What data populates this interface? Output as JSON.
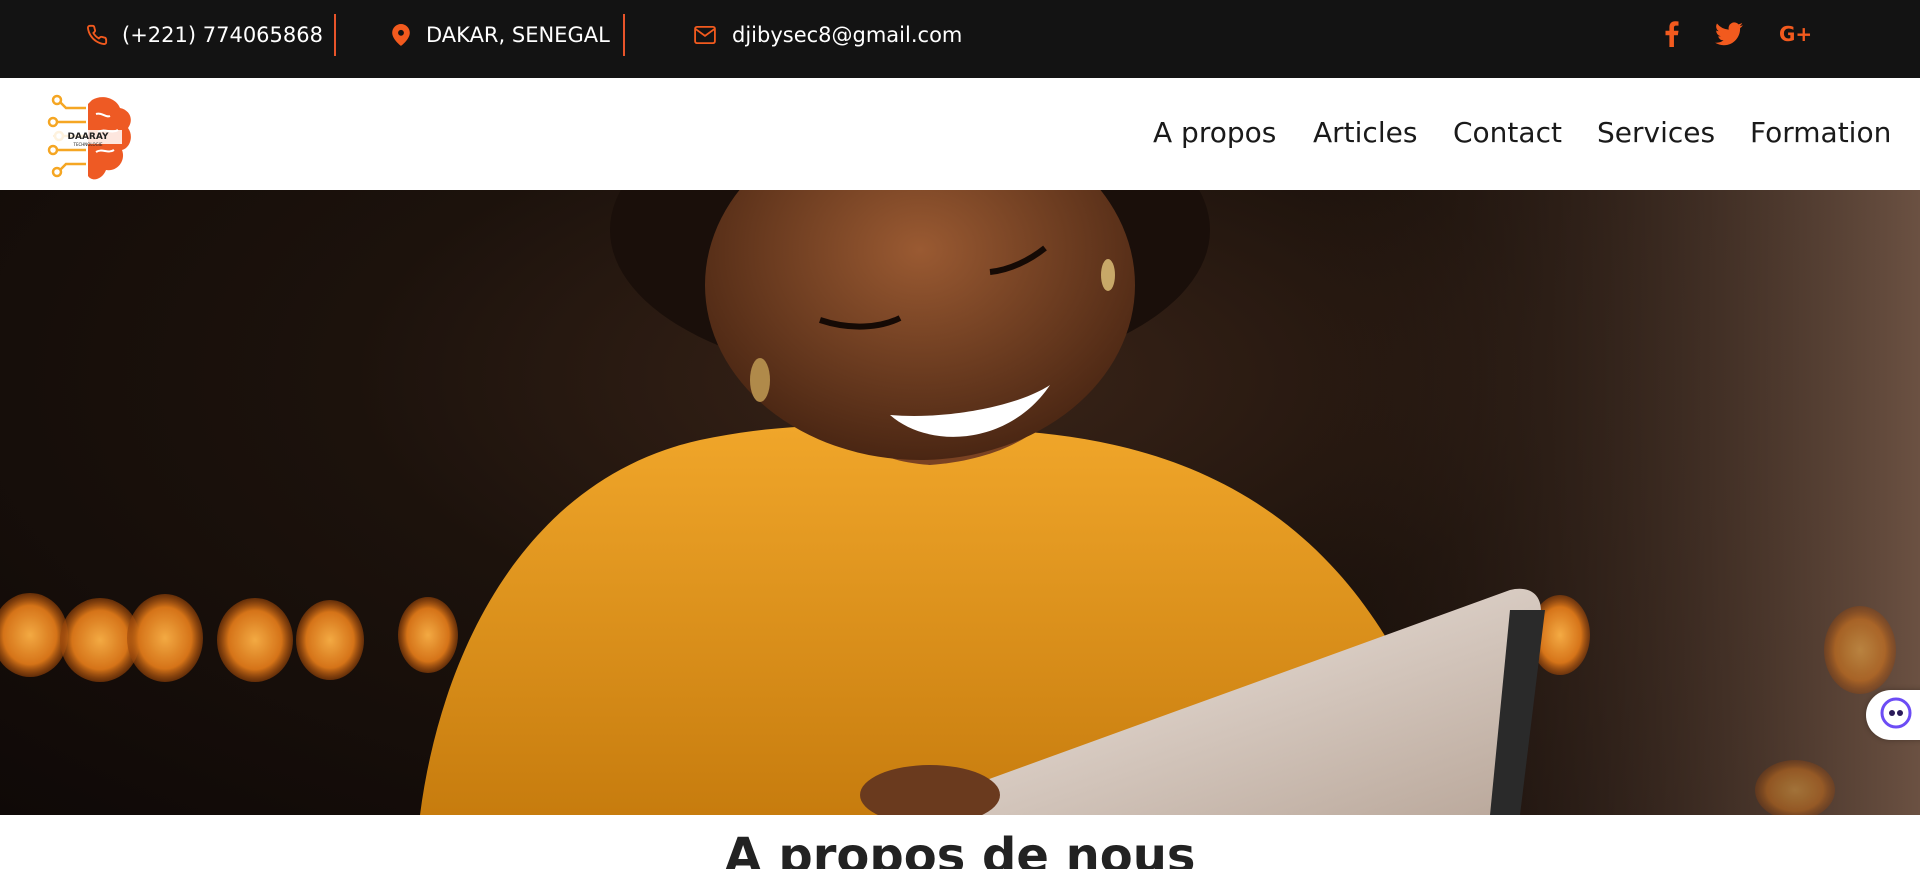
{
  "topbar": {
    "phone": "(+221) 774065868",
    "location": "DAKAR, SENEGAL",
    "email": "djibysec8@gmail.com",
    "social": [
      {
        "name": "facebook-icon",
        "glyph": "f"
      },
      {
        "name": "twitter-icon",
        "glyph": ""
      },
      {
        "name": "google-plus-icon",
        "glyph": "G+"
      }
    ]
  },
  "brand": {
    "logo_text": "DAARAY",
    "logo_subtext": "TECHNOLOGIE"
  },
  "nav": {
    "items": [
      "A propos",
      "Articles",
      "Contact",
      "Services",
      "Formation"
    ]
  },
  "main": {
    "section_title": "A propos de nous"
  },
  "colors": {
    "accent": "#f25a1e",
    "topbar_bg": "#131313",
    "text_dark": "#1a1a1a"
  }
}
